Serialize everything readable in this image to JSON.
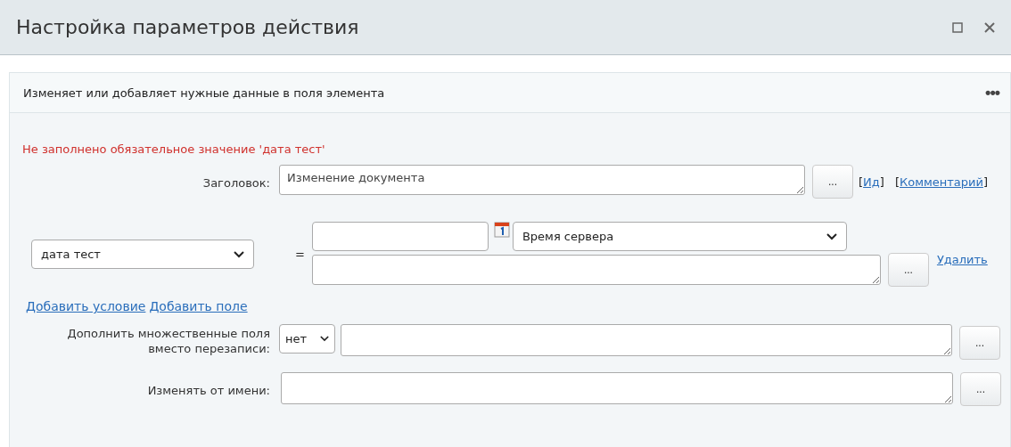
{
  "window": {
    "title": "Настройка параметров действия"
  },
  "panel": {
    "description": "Изменяет или добавляет нужные данные в поля элемента",
    "menu_glyph": "•••"
  },
  "error": "Не заполнено обязательное значение 'дата тест'",
  "title_row": {
    "label": "Заголовок:",
    "value": "Изменение документа",
    "button": "...",
    "links": [
      {
        "open": "[",
        "text": "Ид",
        "close": "]"
      },
      {
        "open": "[",
        "text": "Комментарий",
        "close": "]"
      }
    ]
  },
  "field_row": {
    "field": "дата тест",
    "equals": "=",
    "timezone": "Время сервера",
    "button": "...",
    "delete_link": "Удалить"
  },
  "add_links": [
    "Добавить условие",
    "Добавить поле"
  ],
  "append_row": {
    "label": "Дополнить множественные поля вместо перезаписи:",
    "choice": "нет",
    "button": "..."
  },
  "author_row": {
    "label": "Изменять от имени:",
    "button": "..."
  }
}
